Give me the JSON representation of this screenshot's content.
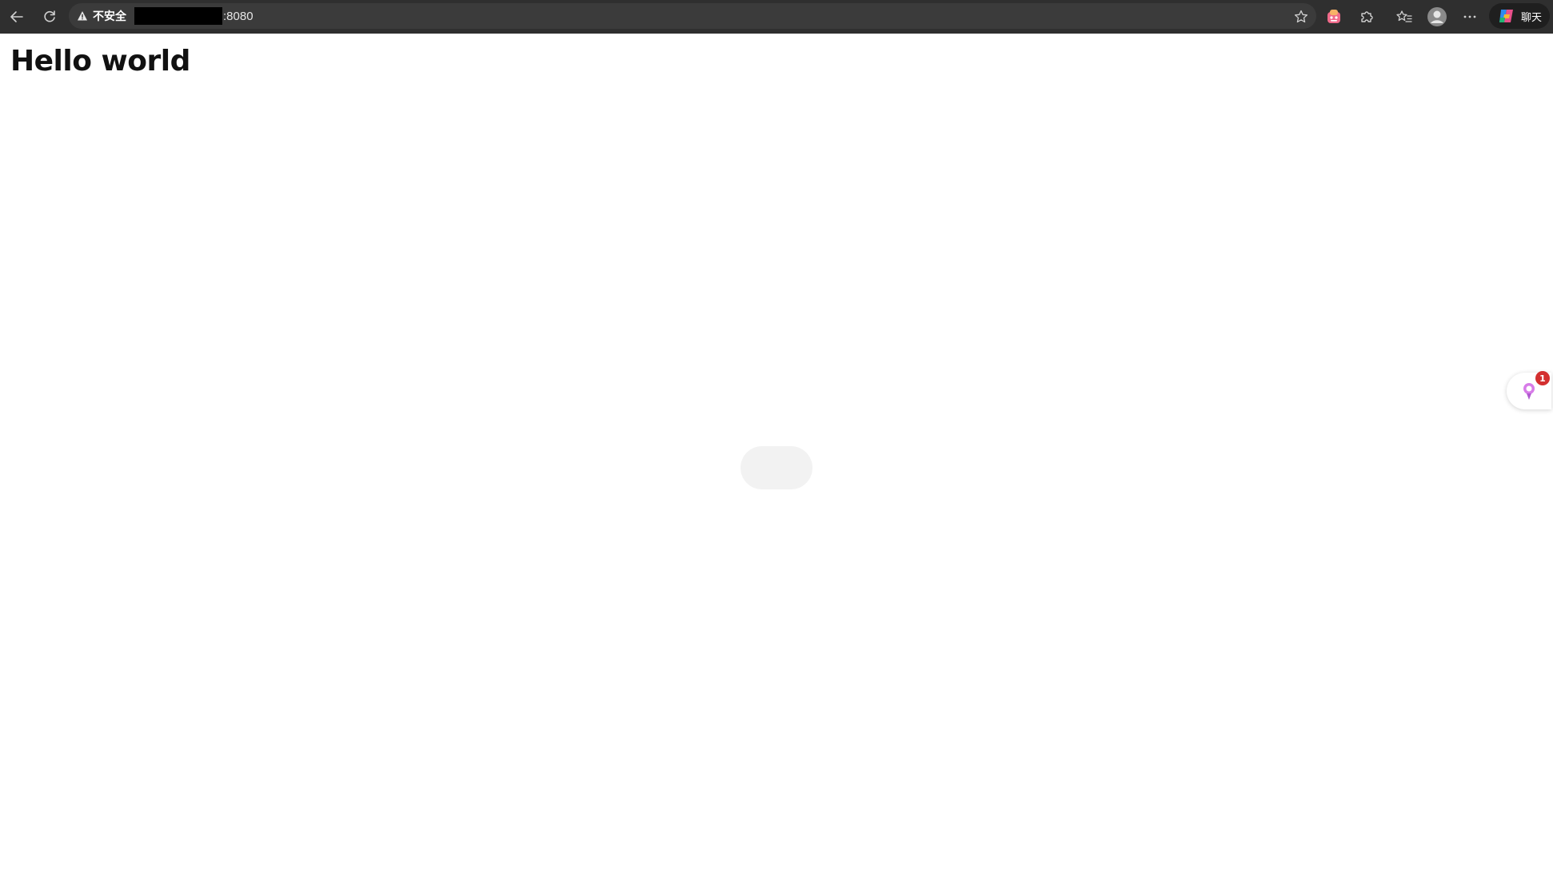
{
  "toolbar": {
    "security_label": "不安全",
    "url_port": ":8080",
    "chat_label": "聊天",
    "icons": [
      "back-arrow-icon",
      "refresh-icon",
      "warning-icon",
      "star-icon",
      "extension-app-icon",
      "puzzle-icon",
      "favorites-icon",
      "profile-icon",
      "more-icon",
      "copilot-icon"
    ]
  },
  "page": {
    "title": "Hello world"
  },
  "side_widget": {
    "badge_count": "1",
    "icon": "assistant-icon"
  }
}
